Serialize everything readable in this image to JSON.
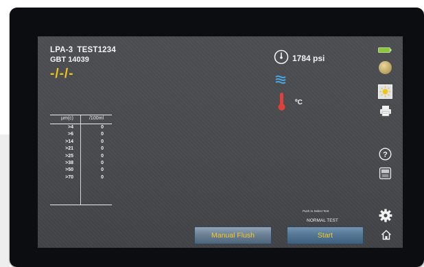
{
  "header": {
    "model": "LPA-3",
    "device_id": "TEST1234",
    "gbt": "GBT 14039",
    "date": "-/-/-"
  },
  "status": {
    "pressure": "1784 psi",
    "temperature_unit": "ºC"
  },
  "table": {
    "columns": [
      "µm(c)",
      "/100ml"
    ],
    "rows": [
      [
        ">4",
        "0"
      ],
      [
        ">6",
        "0"
      ],
      [
        ">14",
        "0"
      ],
      [
        ">21",
        "0"
      ],
      [
        ">25",
        "0"
      ],
      [
        ">38",
        "0"
      ],
      [
        ">50",
        "0"
      ],
      [
        ">70",
        "0"
      ]
    ]
  },
  "test_mode": {
    "caption": "Push to Select Test",
    "value": "NORMAL TEST"
  },
  "buttons": {
    "manual_flush": "Manual Flush",
    "start": "Start"
  },
  "colors": {
    "accent_yellow": "#f2c51c",
    "screen_bg": "#46484c",
    "battery_green": "#8cc63f",
    "thermometer_red": "#e0403a",
    "water_blue": "#4aa8e8"
  },
  "icons": [
    "battery-icon",
    "brightness-icon",
    "sun-icon",
    "printer-icon",
    "help-icon",
    "memory-card-icon",
    "gear-icon",
    "home-icon",
    "pressure-gauge-icon",
    "water-waves-icon",
    "thermometer-icon"
  ]
}
